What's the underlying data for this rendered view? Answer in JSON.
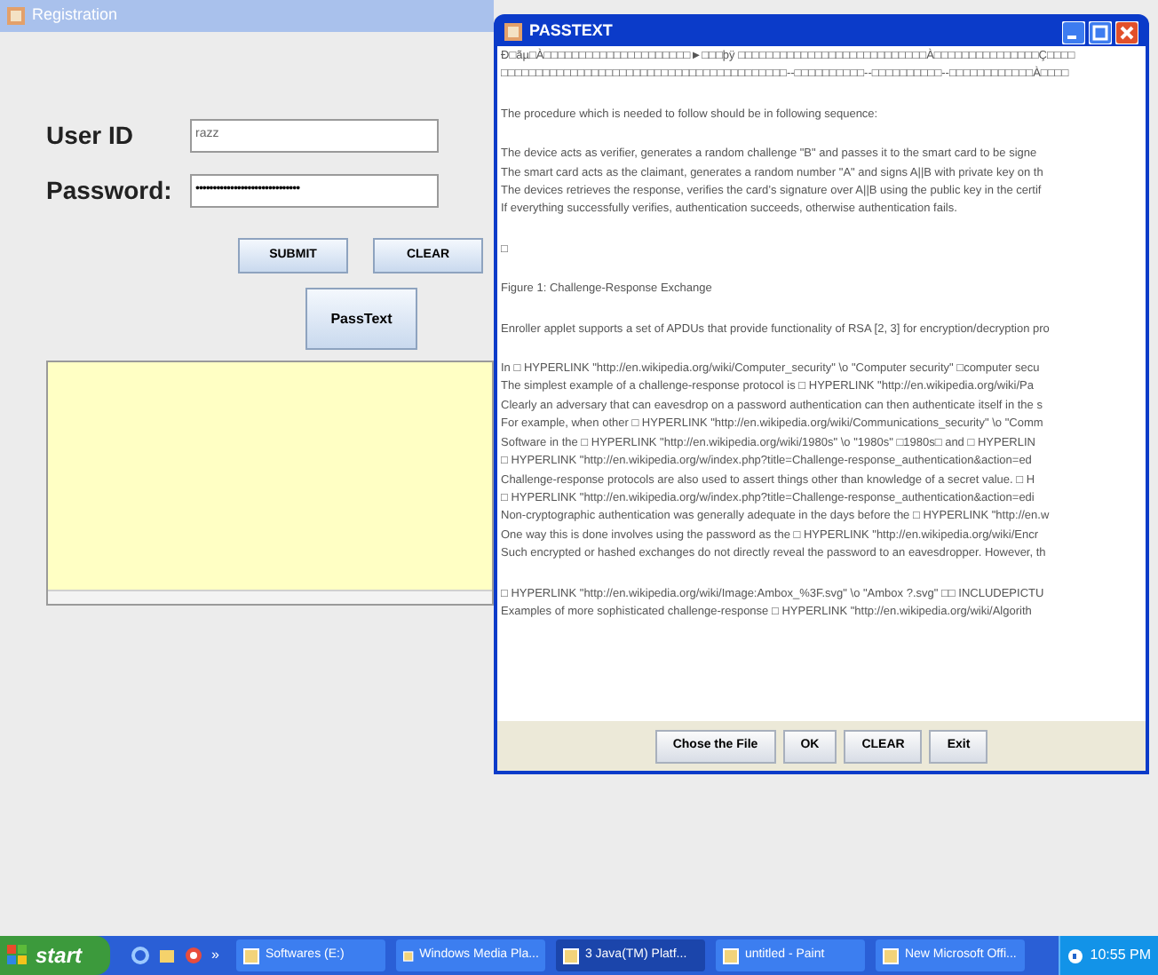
{
  "registration": {
    "title": "Registration",
    "fields": [
      {
        "label": "User ID",
        "value": "razz",
        "kind": "text"
      },
      {
        "label": "Password:",
        "value": "••••••••••••••••••••••••••••••",
        "kind": "password"
      }
    ],
    "buttons": [
      "SUBMIT",
      "CLEAR"
    ],
    "passtext_button": "PassText"
  },
  "passtext": {
    "title": "PASSTEXT",
    "paragraphs": [
      [
        "Ð□ãµ□À□□□□□□□□□□□□□□□□□□□□□►□□□þÿ       □□□□□□□□□□□□□□□□□□□□□□□□□□□À□□□□□□□□□□□□□□□Ç□□□□",
        "□□□□□□□□□□□□□□□□□□□□□□□□□□□□□□□□□□□□□□□□□--□□□□□□□□□□--□□□□□□□□□□--□□□□□□□□□□□□À□□□□"
      ],
      [
        "The procedure which is needed to follow should be in following sequence:"
      ],
      [
        "The device acts as verifier, generates a random challenge \"B\" and passes it to the smart card to be signe",
        "The smart card acts as the claimant, generates a random number \"A\" and signs A||B with private key on th",
        "The devices retrieves the response, verifies the card’s signature over A||B using the public key in the certif",
        "If everything successfully verifies, authentication succeeds, otherwise authentication fails."
      ],
      [
        "□"
      ],
      [
        "Figure 1: Challenge-Response Exchange"
      ],
      [
        "Enroller applet supports a set of APDUs that provide functionality of RSA [2, 3] for encryption/decryption pro"
      ],
      [
        "In □ HYPERLINK \"http://en.wikipedia.org/wiki/Computer_security\" \\o \"Computer security\" □computer secu",
        "The simplest example of a challenge-response protocol is □ HYPERLINK \"http://en.wikipedia.org/wiki/Pa",
        "Clearly an adversary that can eavesdrop on a password authentication can then authenticate itself in the s",
        "For example, when other □ HYPERLINK \"http://en.wikipedia.org/wiki/Communications_security\" \\o \"Comm",
        "Software in the □ HYPERLINK \"http://en.wikipedia.org/wiki/1980s\" \\o \"1980s\" □1980s□ and □ HYPERLIN",
        "□ HYPERLINK \"http://en.wikipedia.org/w/index.php?title=Challenge-response_authentication&action=ed",
        "Challenge-response protocols are also used to assert things other than knowledge of a secret value. □ H",
        "□ HYPERLINK \"http://en.wikipedia.org/w/index.php?title=Challenge-response_authentication&action=edi",
        "Non-cryptographic authentication was generally adequate in the days before the □ HYPERLINK \"http://en.w",
        "One way this is done involves using the password as the □ HYPERLINK \"http://en.wikipedia.org/wiki/Encr",
        "Such encrypted or hashed exchanges do not directly reveal the password to an eavesdropper. However, th"
      ],
      [
        "□ HYPERLINK \"http://en.wikipedia.org/wiki/Image:Ambox_%3F.svg\" \\o \"Ambox ?.svg\" □□ INCLUDEPICTU",
        "Examples of more sophisticated challenge-response □ HYPERLINK \"http://en.wikipedia.org/wiki/Algorith"
      ]
    ],
    "buttons": [
      "Chose the File",
      "OK",
      "CLEAR",
      "Exit"
    ]
  },
  "taskbar": {
    "start": "start",
    "overflow": "»",
    "items": [
      {
        "label": "Softwares (E:)",
        "selected": false
      },
      {
        "label": "Windows Media Pla...",
        "selected": false
      },
      {
        "label": "3 Java(TM) Platf...",
        "selected": true
      },
      {
        "label": "untitled - Paint",
        "selected": false
      },
      {
        "label": "New Microsoft Offi...",
        "selected": false
      }
    ],
    "clock": "10:55 PM"
  }
}
